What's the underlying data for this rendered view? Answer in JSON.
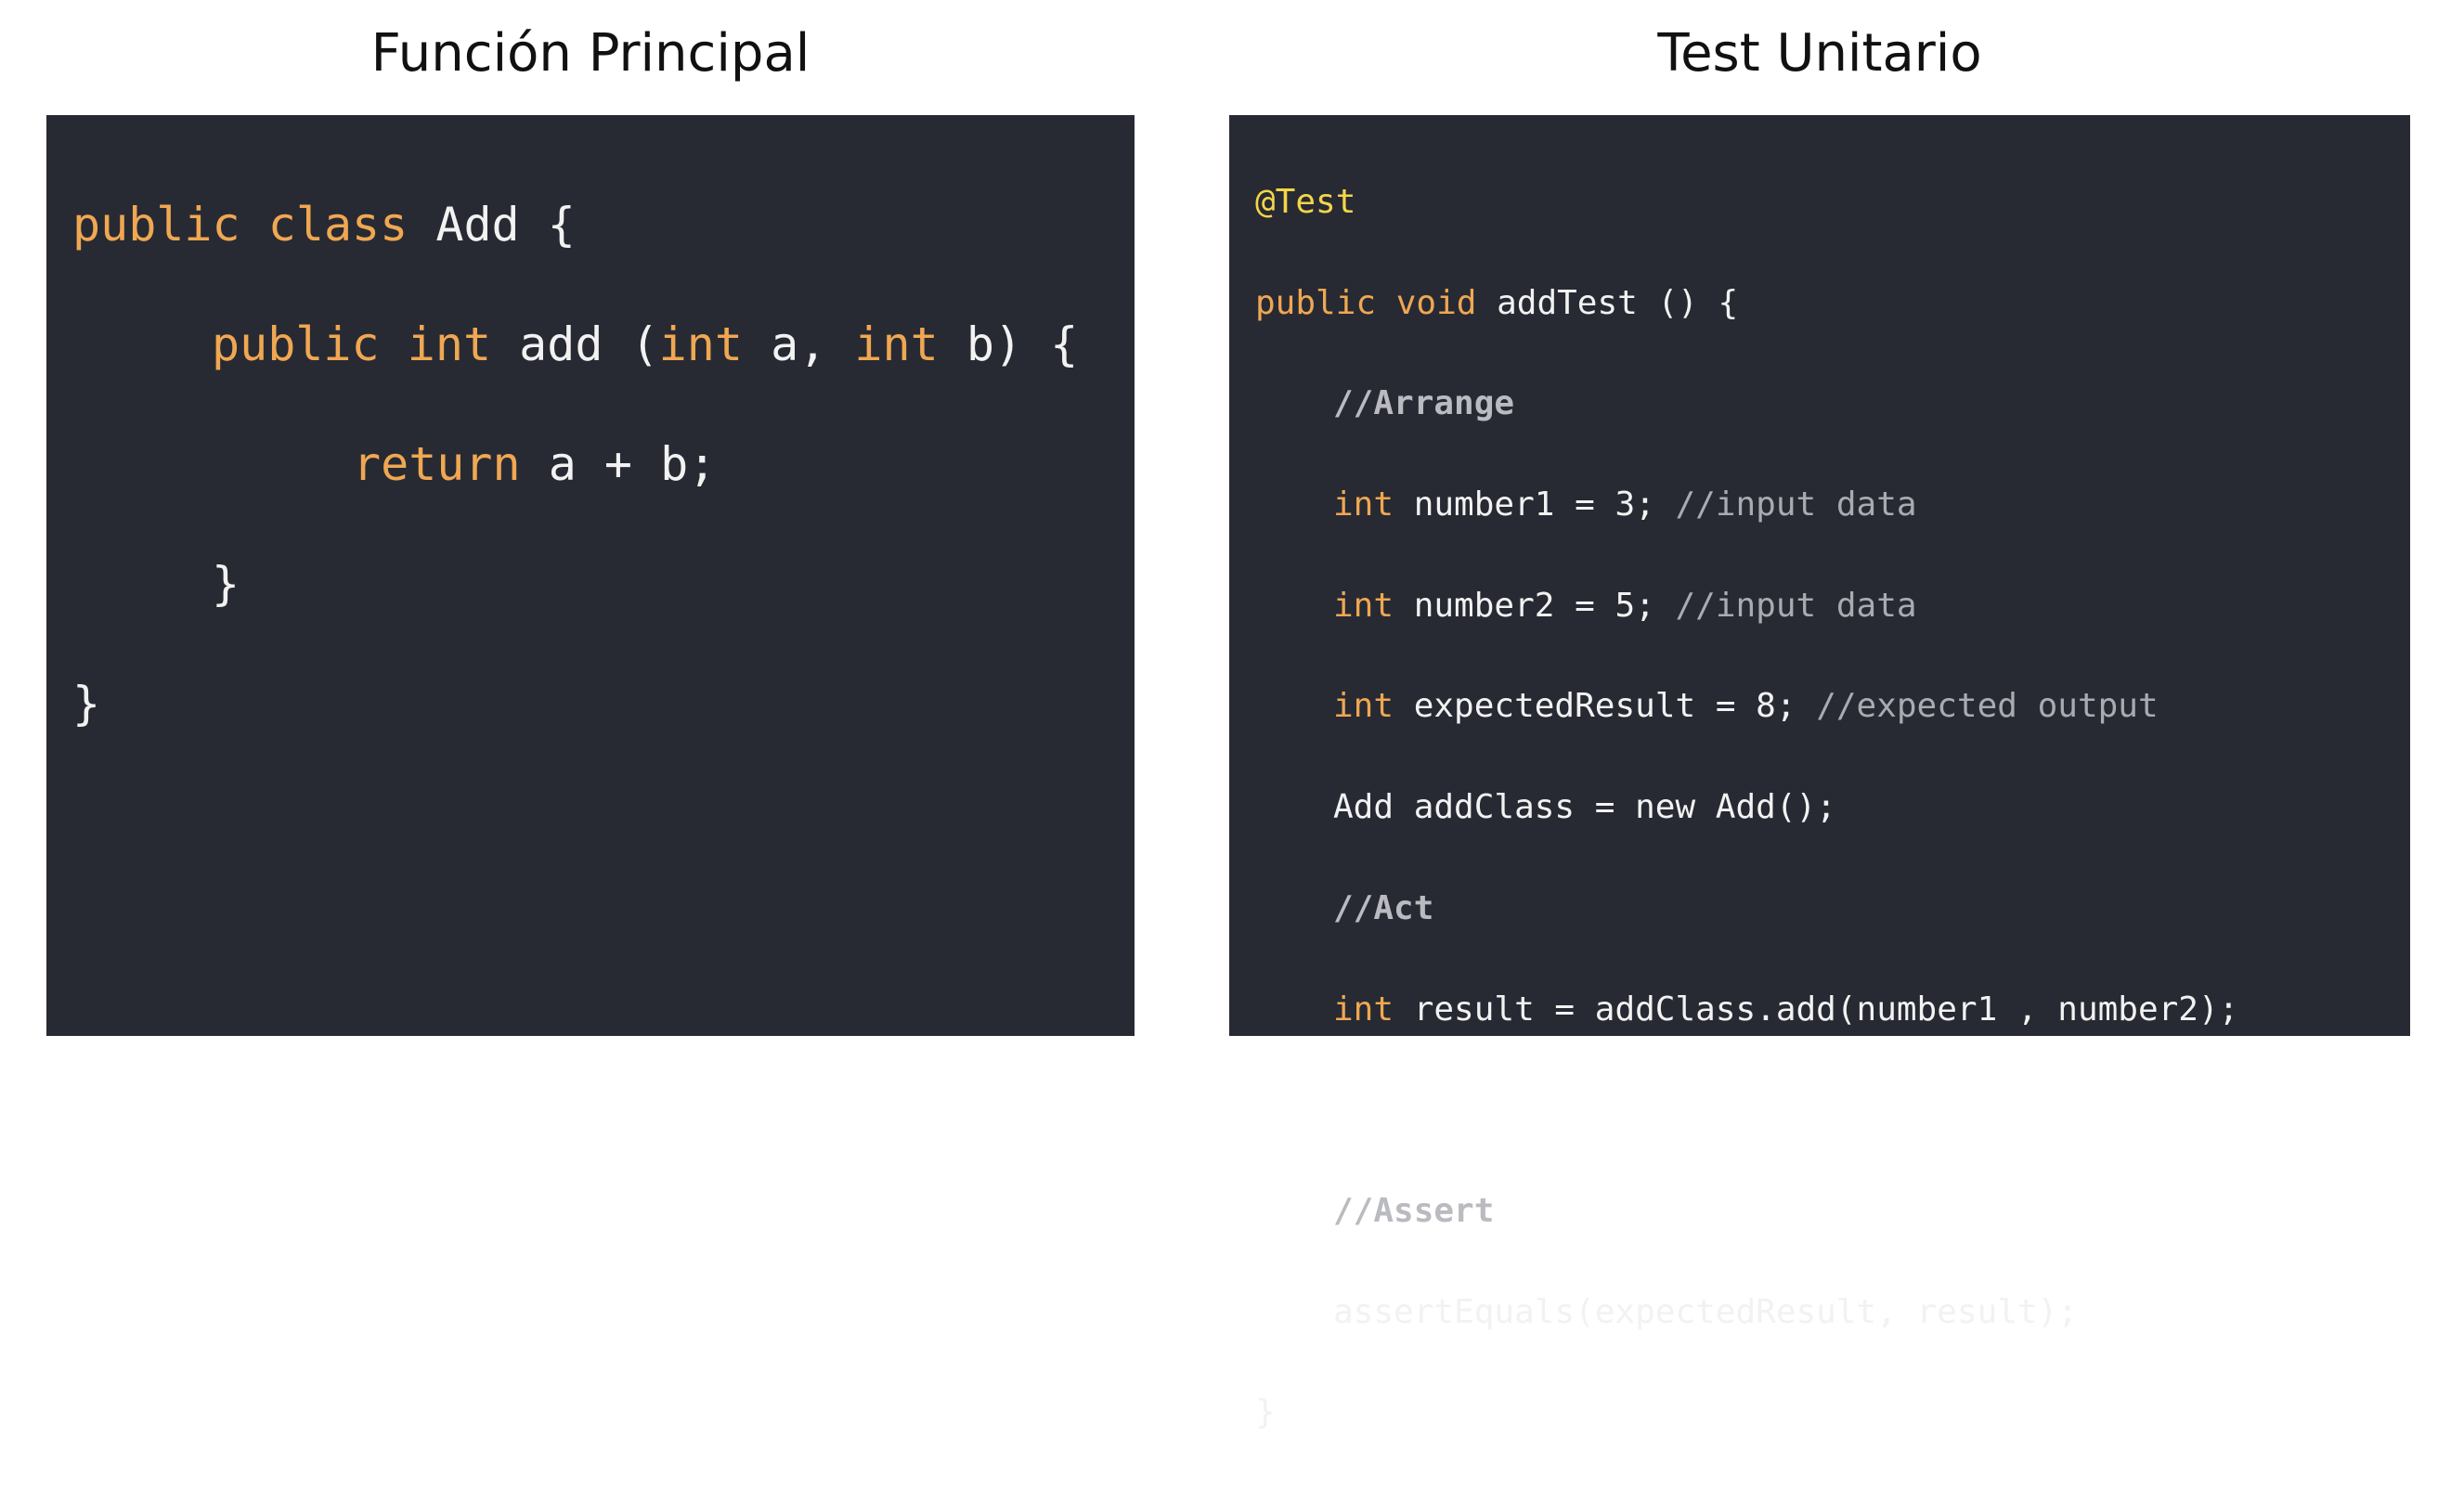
{
  "titles": {
    "left": "Función Principal",
    "right": "Test Unitario"
  },
  "main_code": {
    "l1": {
      "kw1": "public",
      "kw2": "class",
      "rest": " Add {"
    },
    "l2": {
      "kw1": "public",
      "kw2": "int",
      "mid1": " add (",
      "kw3": "int",
      "mid2": " a, ",
      "kw4": "int",
      "rest": " b) {"
    },
    "l3": {
      "kw1": "return",
      "rest": " a + b;"
    },
    "l4": {
      "rest": "}"
    },
    "l5": {
      "rest": "}"
    }
  },
  "test_code": {
    "l1": {
      "ann": "@Test"
    },
    "l2": {
      "kw1": "public",
      "kw2": "void",
      "rest": " addTest () {"
    },
    "l3": {
      "comment": "//Arrange"
    },
    "l4": {
      "kw": "int",
      "rest": " number1 = 3; ",
      "comment": "//input data"
    },
    "l5": {
      "kw": "int",
      "rest": " number2 = 5; ",
      "comment": "//input data"
    },
    "l6": {
      "kw": "int",
      "rest": " expectedResult = 8; ",
      "comment": "//expected output"
    },
    "l7": {
      "rest": "Add addClass = new Add();"
    },
    "l8": {
      "comment": "//Act"
    },
    "l9": {
      "kw": "int",
      "rest": " result = addClass.add(number1 , number2);"
    },
    "l11": {
      "comment": "//Assert"
    },
    "l12": {
      "rest": "assertEquals(expectedResult, result);"
    },
    "l13": {
      "rest": "}"
    }
  },
  "colors": {
    "panel_bg": "#272a33",
    "keyword": "#f0a752",
    "annotation": "#f5d547",
    "comment": "#a9abb0",
    "text": "#f2f2f2"
  }
}
